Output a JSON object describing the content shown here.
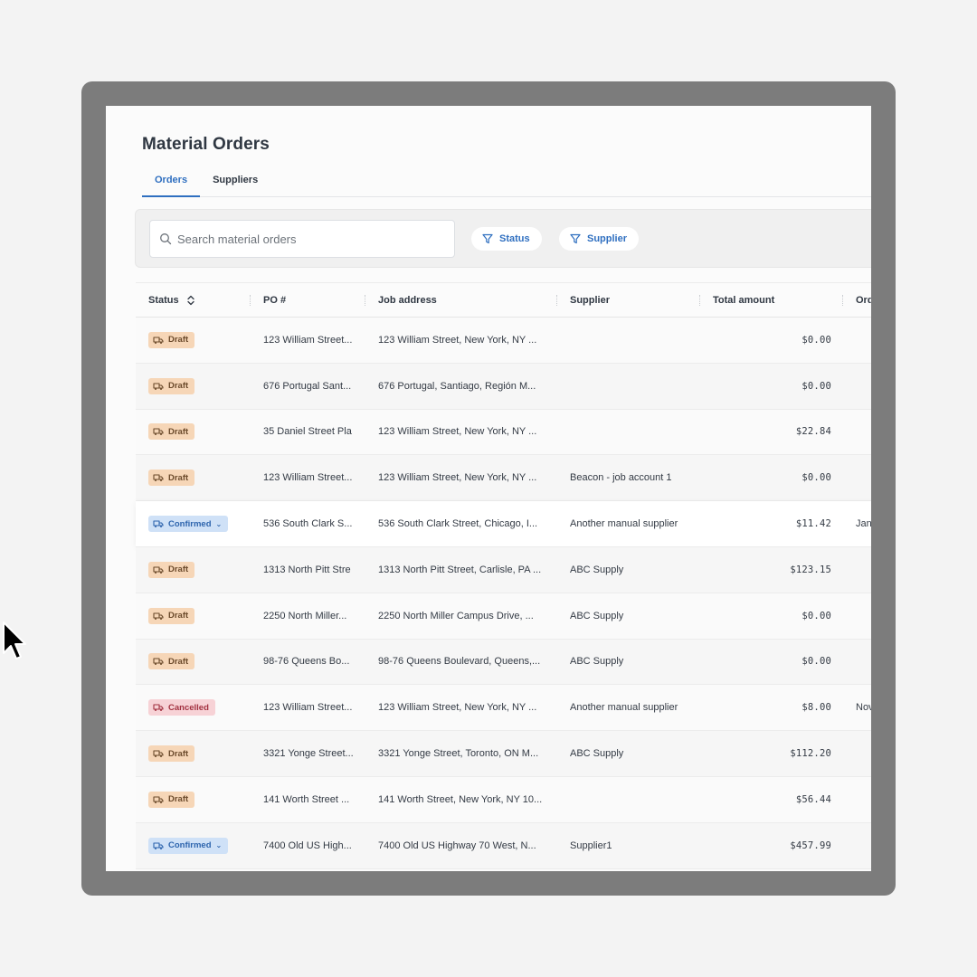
{
  "page": {
    "title": "Material Orders"
  },
  "tabs": [
    {
      "label": "Orders",
      "active": true
    },
    {
      "label": "Suppliers",
      "active": false
    }
  ],
  "search": {
    "placeholder": "Search material orders",
    "value": ""
  },
  "filters": [
    {
      "label": "Status",
      "icon": "filter-icon"
    },
    {
      "label": "Supplier",
      "icon": "filter-icon"
    }
  ],
  "table": {
    "columns": [
      "Status",
      "PO #",
      "Job address",
      "Supplier",
      "Total amount",
      "Ord"
    ],
    "rows": [
      {
        "status": "Draft",
        "po": "123 William Street...",
        "address": "123 William Street, New York, NY ...",
        "supplier": "",
        "total": "$0.00",
        "order": ""
      },
      {
        "status": "Draft",
        "po": "676 Portugal Sant...",
        "address": "676 Portugal, Santiago, Región M...",
        "supplier": "",
        "total": "$0.00",
        "order": ""
      },
      {
        "status": "Draft",
        "po": "35 Daniel Street Pla",
        "address": "123 William Street, New York, NY ...",
        "supplier": "",
        "total": "$22.84",
        "order": ""
      },
      {
        "status": "Draft",
        "po": "123 William Street...",
        "address": "123 William Street, New York, NY ...",
        "supplier": "Beacon - job account 1",
        "total": "$0.00",
        "order": ""
      },
      {
        "status": "Confirmed",
        "po": "536 South Clark S...",
        "address": "536 South Clark Street, Chicago, I...",
        "supplier": "Another manual supplier",
        "total": "$11.42",
        "order": "Jan"
      },
      {
        "status": "Draft",
        "po": "1313 North Pitt Stre",
        "address": "1313 North Pitt Street, Carlisle, PA ...",
        "supplier": "ABC Supply",
        "total": "$123.15",
        "order": ""
      },
      {
        "status": "Draft",
        "po": "2250 North Miller...",
        "address": "2250 North Miller Campus Drive, ...",
        "supplier": "ABC Supply",
        "total": "$0.00",
        "order": ""
      },
      {
        "status": "Draft",
        "po": "98-76 Queens Bo...",
        "address": "98-76 Queens Boulevard, Queens,...",
        "supplier": "ABC Supply",
        "total": "$0.00",
        "order": ""
      },
      {
        "status": "Cancelled",
        "po": "123 William Street...",
        "address": "123 William Street, New York, NY ...",
        "supplier": "Another manual supplier",
        "total": "$8.00",
        "order": "Nov"
      },
      {
        "status": "Draft",
        "po": "3321 Yonge Street...",
        "address": "3321 Yonge Street, Toronto, ON M...",
        "supplier": "ABC Supply",
        "total": "$112.20",
        "order": ""
      },
      {
        "status": "Draft",
        "po": "141 Worth Street ...",
        "address": "141 Worth Street, New York, NY 10...",
        "supplier": "",
        "total": "$56.44",
        "order": ""
      },
      {
        "status": "Confirmed",
        "po": "7400 Old US High...",
        "address": "7400 Old US Highway 70 West, N...",
        "supplier": "Supplier1",
        "total": "$457.99",
        "order": ""
      }
    ]
  },
  "colors": {
    "accent": "#2f6fc0",
    "draft": "#f6d6b7",
    "confirmed": "#cfe1f7",
    "cancelled": "#f7d2d6"
  }
}
